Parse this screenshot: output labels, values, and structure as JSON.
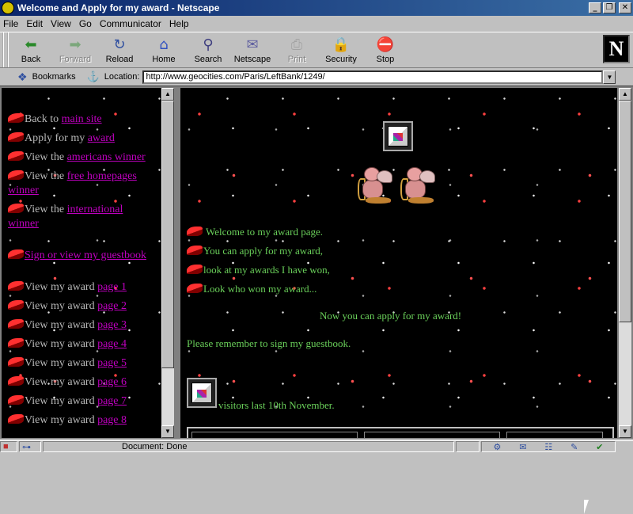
{
  "window": {
    "title": "Welcome and Apply for my award - Netscape",
    "min_label": "_",
    "max_label": "❐",
    "close_label": "✕"
  },
  "menu": [
    "File",
    "Edit",
    "View",
    "Go",
    "Communicator",
    "Help"
  ],
  "toolbar": {
    "buttons": [
      {
        "label": "Back",
        "icon": "back-arrow-icon",
        "glyph": "⬅",
        "color": "#2a8a2a"
      },
      {
        "label": "Forward",
        "icon": "forward-arrow-icon",
        "glyph": "➡",
        "color": "#7ab07a"
      },
      {
        "label": "Reload",
        "icon": "reload-icon",
        "glyph": "↻",
        "color": "#3050a0"
      },
      {
        "label": "Home",
        "icon": "home-icon",
        "glyph": "⌂",
        "color": "#3050c0"
      },
      {
        "label": "Search",
        "icon": "search-icon",
        "glyph": "⚲",
        "color": "#404080"
      },
      {
        "label": "Netscape",
        "icon": "netscape-icon",
        "glyph": "✉",
        "color": "#6060a0"
      },
      {
        "label": "Print",
        "icon": "print-icon",
        "glyph": "⎙",
        "color": "#808080"
      },
      {
        "label": "Security",
        "icon": "security-lock-icon",
        "glyph": "🔒",
        "color": "#b08020"
      },
      {
        "label": "Stop",
        "icon": "stop-icon",
        "glyph": "⛔",
        "color": "#c02020"
      }
    ],
    "logo": "N"
  },
  "location": {
    "bookmarks_label": "Bookmarks",
    "location_label": "Location:",
    "url": "http://www.geocities.com/Paris/LeftBank/1249/"
  },
  "left_frame": {
    "links": [
      {
        "prefix": "Back to ",
        "link": "main site"
      },
      {
        "prefix": "Apply for my ",
        "link": "award"
      },
      {
        "prefix": "View the ",
        "link": "americans winner"
      },
      {
        "prefix": "View the ",
        "link": "free homepages",
        "wrap": "winner"
      },
      {
        "prefix": "View the ",
        "link": "international",
        "wrap": "winner"
      },
      {
        "prefix": "",
        "link": "Sign or view my guestbook"
      },
      {
        "prefix": "View my award ",
        "link": "page 1"
      },
      {
        "prefix": "View my award ",
        "link": "page 2"
      },
      {
        "prefix": "View my award ",
        "link": "page 3"
      },
      {
        "prefix": "View my award ",
        "link": "page 4"
      },
      {
        "prefix": "View my award ",
        "link": "page 5"
      },
      {
        "prefix": "View my award ",
        "link": "page 6"
      },
      {
        "prefix": "View my award ",
        "link": "page 7"
      },
      {
        "prefix": "View my award ",
        "link": "page 8"
      }
    ]
  },
  "right_frame": {
    "welcome_lines": [
      "Welcome to my award page.",
      "You can apply for my award,",
      "look at my awards I have won,",
      "Look who won my award..."
    ],
    "apply_line": "Now you can apply for my award!",
    "guestbook_line": "Please remember to sign my guestbook.",
    "visitors_line": "visitors last 10th November."
  },
  "status": {
    "text": "Document: Done"
  }
}
